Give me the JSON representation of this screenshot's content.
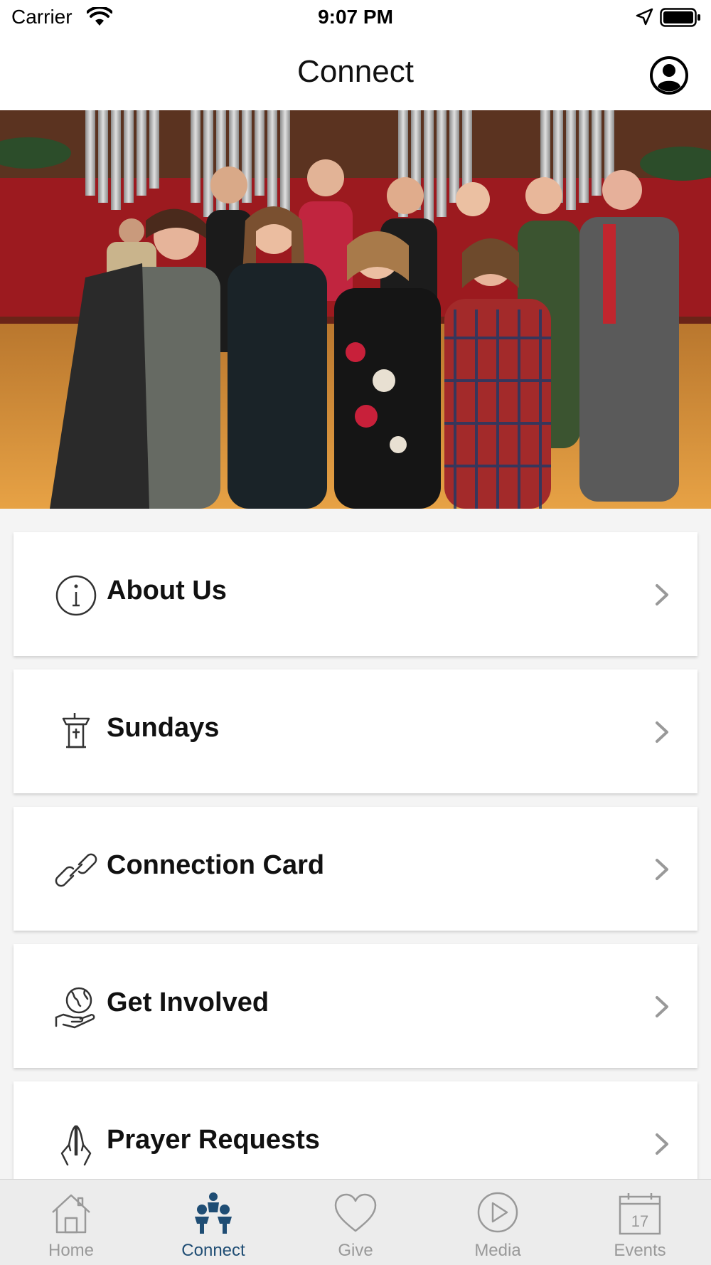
{
  "status_bar": {
    "carrier": "Carrier",
    "time": "9:07 PM"
  },
  "header": {
    "title": "Connect",
    "profile_icon": "person-circle-icon"
  },
  "hero": {
    "description_icon": "group-photo"
  },
  "menu": {
    "items": [
      {
        "label": "About Us",
        "icon": "info-circle-icon"
      },
      {
        "label": "Sundays",
        "icon": "pulpit-icon"
      },
      {
        "label": "Connection Card",
        "icon": "link-icon"
      },
      {
        "label": "Get Involved",
        "icon": "globe-hand-icon"
      },
      {
        "label": "Prayer Requests",
        "icon": "praying-hands-icon"
      }
    ]
  },
  "tab_bar": {
    "active": "Connect",
    "tabs": [
      {
        "label": "Home",
        "icon": "house-icon"
      },
      {
        "label": "Connect",
        "icon": "people-icon"
      },
      {
        "label": "Give",
        "icon": "heart-icon"
      },
      {
        "label": "Media",
        "icon": "play-circle-icon"
      },
      {
        "label": "Events",
        "icon": "calendar-icon",
        "calendar_day": "17"
      }
    ]
  },
  "colors": {
    "accent": "#1f4d74",
    "inactive_tab": "#999999",
    "background": "#f4f4f4"
  }
}
